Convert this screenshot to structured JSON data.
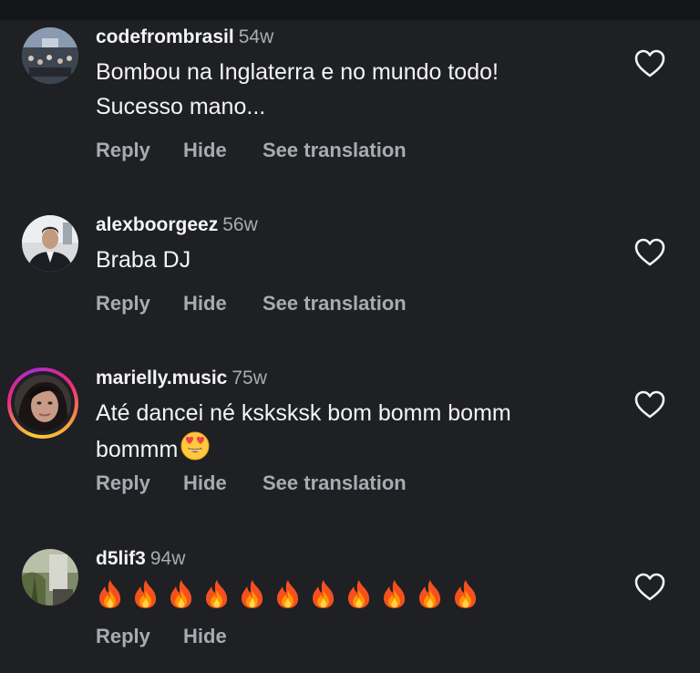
{
  "comments": [
    {
      "username": "codefrombrasil",
      "age": "54w",
      "text_line1": "Bombou na Inglaterra e no mundo todo!",
      "text_line2": "Sucesso mano...",
      "reply": "Reply",
      "hide": "Hide",
      "translate": "See translation"
    },
    {
      "username": "alexboorgeez",
      "age": "56w",
      "text_line1": "Braba DJ",
      "reply": "Reply",
      "hide": "Hide",
      "translate": "See translation"
    },
    {
      "username": "marielly.music",
      "age": "75w",
      "text_line1": "Até dancei né ksksksk bom bomm bomm",
      "text_line2": "bommm",
      "reply": "Reply",
      "hide": "Hide",
      "translate": "See translation"
    },
    {
      "username": "d5lif3",
      "age": "94w",
      "fire_count": 11,
      "reply": "Reply",
      "hide": "Hide"
    }
  ],
  "colors": {
    "background": "#1e2024",
    "primary_text": "#f4f4f5",
    "secondary_text": "#a9abb1",
    "story_ring_start": "#f9ce34",
    "story_ring_end": "#ee2a7b"
  },
  "icons": {
    "like": "heart-outline-icon",
    "emoji_eyes": "heart-eyes-emoji",
    "emoji_fire": "fire-emoji"
  }
}
